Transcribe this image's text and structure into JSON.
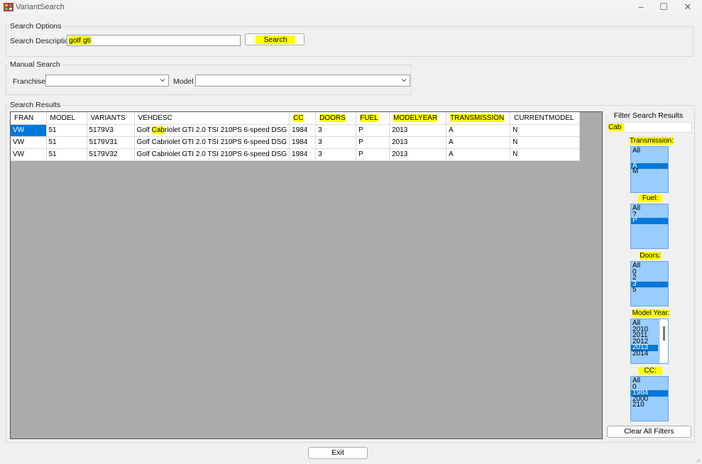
{
  "window": {
    "title": "VariantSearch",
    "minimize": "–",
    "maximize": "☐",
    "close": "✕"
  },
  "search_options": {
    "group_label": "Search Options",
    "description_label": "Search Description",
    "description_value": "golf gti",
    "search_button": "Search"
  },
  "manual_search": {
    "group_label": "Manual Search",
    "franchise_label": "Franchise",
    "franchise_value": "",
    "model_label": "Model",
    "model_value": ""
  },
  "search_results": {
    "group_label": "Search Results",
    "columns": [
      "FRAN",
      "MODEL",
      "VARIANTS",
      "VEHDESC",
      "CC",
      "DOORS",
      "FUEL",
      "MODELYEAR",
      "TRANSMISSION",
      "CURRENTMODEL"
    ],
    "rows": [
      [
        "VW",
        "51",
        "5179V3",
        "Golf Cabriolet GTI 2.0 TSI 210PS 6-speed DSG",
        "1984",
        "3",
        "P",
        "2013",
        "A",
        "N"
      ],
      [
        "VW",
        "51",
        "5179V31",
        "Golf Cabriolet GTI 2.0 TSI 210PS 6-speed DSG",
        "1984",
        "3",
        "P",
        "2013",
        "A",
        "N"
      ],
      [
        "VW",
        "51",
        "5179V32",
        "Golf Cabriolet GTI 2.0 TSI 210PS 6-speed DSG",
        "1984",
        "3",
        "P",
        "2013",
        "A",
        "N"
      ]
    ]
  },
  "filters": {
    "title": "Filter Search Results",
    "text_value": "Cab",
    "transmission": {
      "label": "Transmission:",
      "options": [
        "All",
        "",
        "A",
        "M"
      ],
      "selected": "A"
    },
    "fuel": {
      "label": "Fuel:",
      "options": [
        "All",
        "?",
        "P"
      ],
      "selected": "P"
    },
    "doors": {
      "label": "Doors:",
      "options": [
        "All",
        "0",
        "2",
        "3",
        "5"
      ],
      "selected": "3"
    },
    "model_year": {
      "label": "Model Year:",
      "options": [
        "All",
        "2010",
        "2011",
        "2012",
        "2013",
        "2014"
      ],
      "selected": "2013"
    },
    "cc": {
      "label": "CC:",
      "options": [
        "All",
        "0",
        "1984",
        "2000",
        "210"
      ],
      "selected": "1984"
    },
    "clear_button": "Clear All Filters"
  },
  "exit_button": "Exit",
  "colors": {
    "highlight": "#ffff00",
    "selection": "#0078d7",
    "listbox": "#99ccff",
    "grid_bg": "#ababab"
  }
}
